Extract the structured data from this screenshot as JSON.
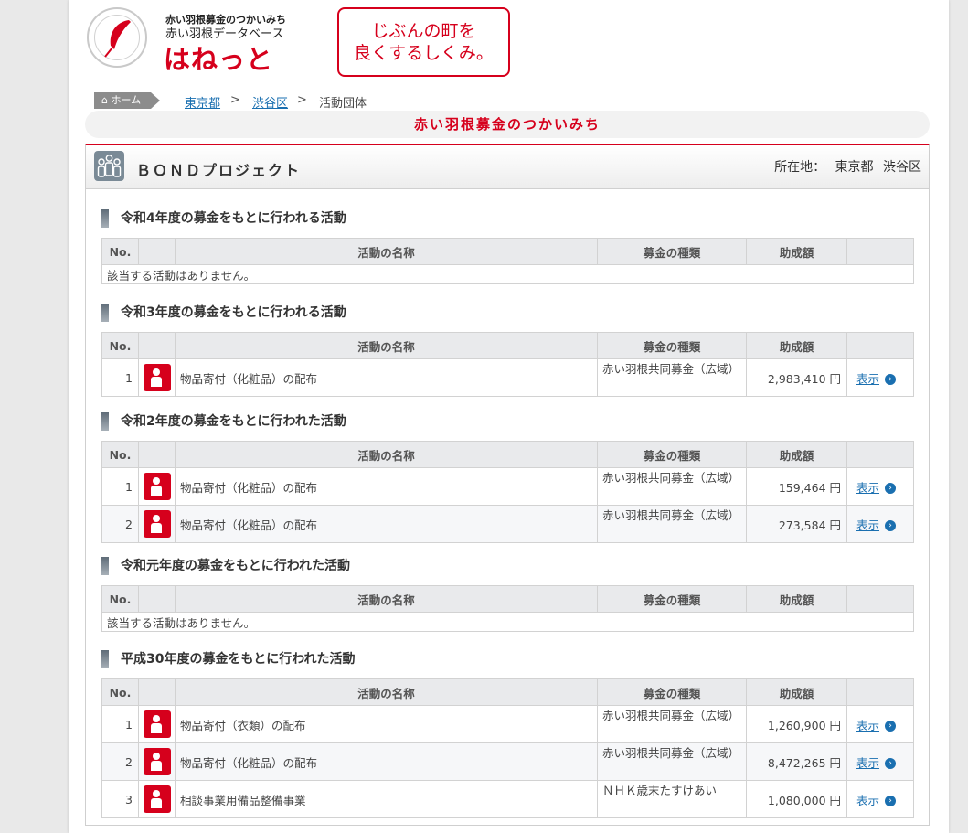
{
  "header": {
    "logo_small1": "赤い羽根募金のつかいみち",
    "logo_small2": "赤い羽根データベース",
    "logo_big": "はねっと",
    "slogan_line1": "じぶんの町を",
    "slogan_line2": "良くするしくみ。"
  },
  "breadcrumb": {
    "home": "ホーム",
    "items": [
      "東京都",
      "渋谷区"
    ],
    "current": "活動団体",
    "sep": ">"
  },
  "band_title": "赤い羽根募金のつかいみち",
  "org": {
    "name": "ＢＯＮＤプロジェクト",
    "location_label": "所在地：",
    "pref": "東京都",
    "city": "渋谷区"
  },
  "columns": {
    "no": "No.",
    "name": "活動の名称",
    "fund": "募金の種類",
    "amount": "助成額"
  },
  "empty_text": "該当する活動はありません。",
  "show_label": "表示",
  "sections": [
    {
      "title": "令和4年度の募金をもとに行われる活動",
      "rows": []
    },
    {
      "title": "令和3年度の募金をもとに行われる活動",
      "rows": [
        {
          "no": "1",
          "name": "物品寄付（化粧品）の配布",
          "fund": "赤い羽根共同募金（広域）",
          "amount": "2,983,410 円"
        }
      ]
    },
    {
      "title": "令和2年度の募金をもとに行われた活動",
      "rows": [
        {
          "no": "1",
          "name": "物品寄付（化粧品）の配布",
          "fund": "赤い羽根共同募金（広域）",
          "amount": "159,464 円"
        },
        {
          "no": "2",
          "name": "物品寄付（化粧品）の配布",
          "fund": "赤い羽根共同募金（広域）",
          "amount": "273,584 円"
        }
      ]
    },
    {
      "title": "令和元年度の募金をもとに行われた活動",
      "rows": []
    },
    {
      "title": "平成30年度の募金をもとに行われた活動",
      "rows": [
        {
          "no": "1",
          "name": "物品寄付（衣類）の配布",
          "fund": "赤い羽根共同募金（広域）",
          "amount": "1,260,900 円"
        },
        {
          "no": "2",
          "name": "物品寄付（化粧品）の配布",
          "fund": "赤い羽根共同募金（広域）",
          "amount": "8,472,265 円"
        },
        {
          "no": "3",
          "name": "相談事業用備品整備事業",
          "fund": "ＮＨＫ歳末たすけあい",
          "amount": "1,080,000 円"
        }
      ]
    }
  ],
  "colors": {
    "accent": "#d6001c",
    "link": "#1a6fb0"
  }
}
